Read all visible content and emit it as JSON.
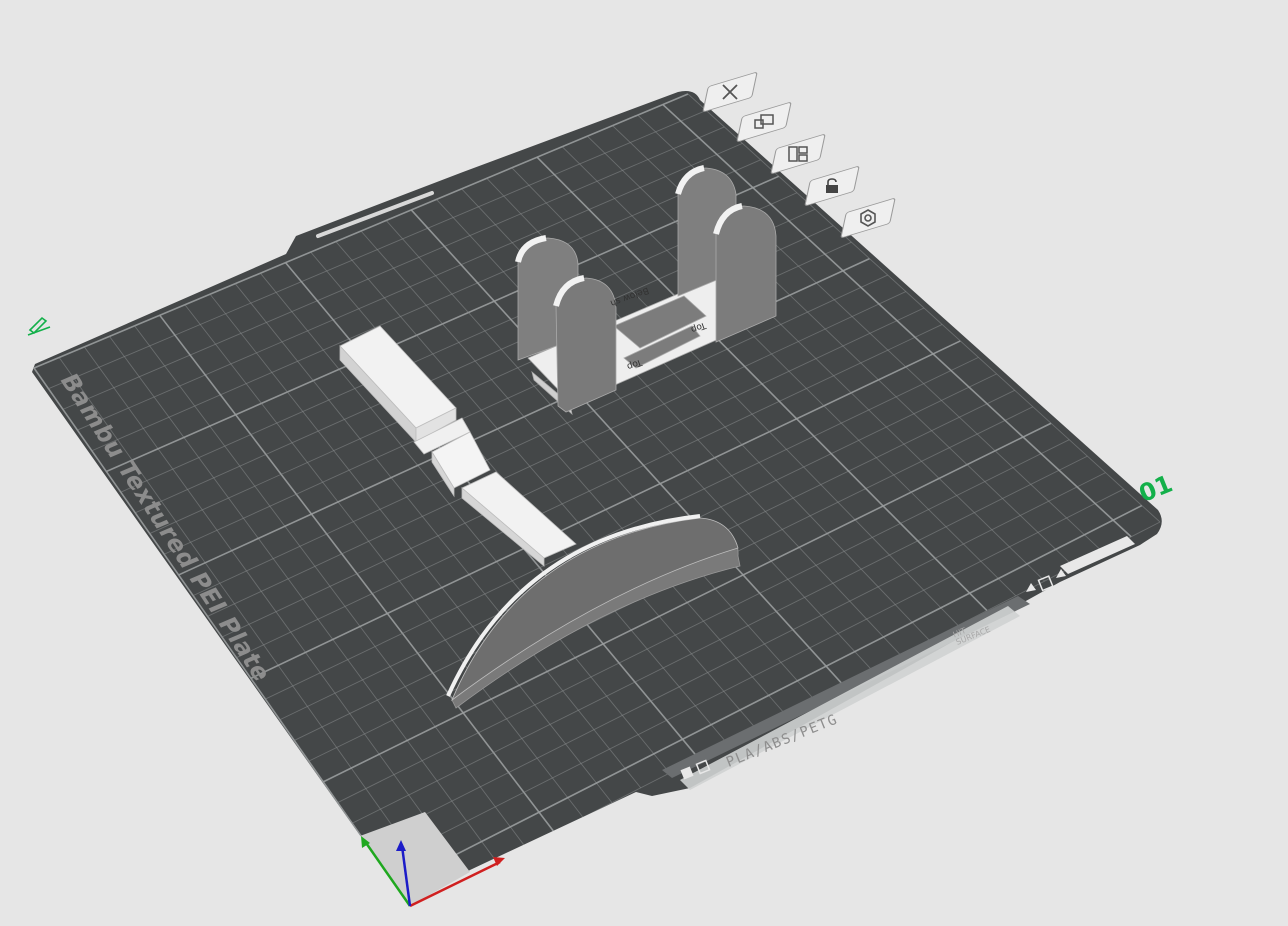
{
  "plate": {
    "name": "Bambu Textured PEI Plate",
    "number": "01",
    "material": "PLA/ABS/PETG",
    "hint_line1": "HIT",
    "hint_line2": "SURFACE"
  },
  "model": {
    "labels": {
      "top_front": "Top",
      "top_right": "Top",
      "below": "Below sh"
    }
  },
  "plate_toolbar": [
    {
      "icon": "close-icon",
      "name": "delete-plate-button"
    },
    {
      "icon": "arrange-icon",
      "name": "plate-settings-button"
    },
    {
      "icon": "layout-icon",
      "name": "auto-arrange-button"
    },
    {
      "icon": "lock-icon",
      "name": "lock-plate-button"
    },
    {
      "icon": "gear-icon",
      "name": "plate-gear-button"
    }
  ],
  "colors": {
    "background": "#e6e6e6",
    "plate": "#444748",
    "grid": "#8a8d8e",
    "model": "#e8e8e8",
    "accent": "#13b04a",
    "axis_x": "#d02020",
    "axis_y": "#1fa81f",
    "axis_z": "#1c1cc8"
  }
}
